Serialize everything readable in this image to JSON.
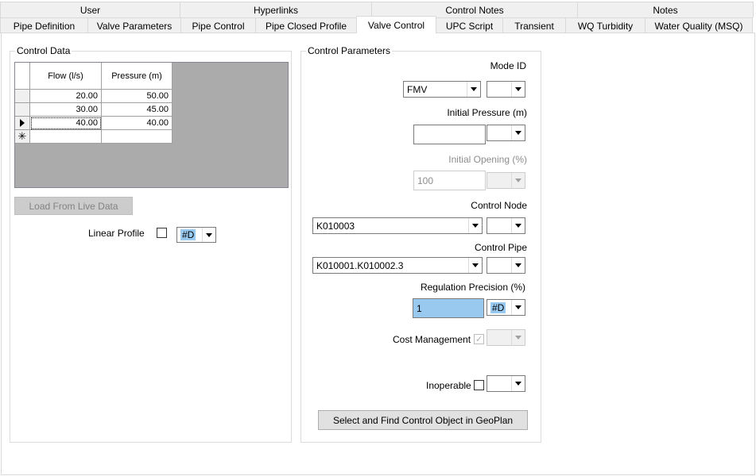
{
  "tabs_top": [
    "User",
    "Hyperlinks",
    "Control Notes",
    "Notes"
  ],
  "tabs_bottom": [
    "Pipe Definition",
    "Valve Parameters",
    "Pipe Control",
    "Pipe Closed Profile",
    "Valve Control",
    "UPC Script",
    "Transient",
    "WQ Turbidity",
    "Water Quality (MSQ)"
  ],
  "active_tab": "Valve Control",
  "control_data": {
    "legend": "Control Data",
    "columns": [
      "Flow (l/s)",
      "Pressure (m)"
    ],
    "rows": [
      {
        "flow": "20.00",
        "pressure": "50.00"
      },
      {
        "flow": "30.00",
        "pressure": "45.00"
      },
      {
        "flow": "40.00",
        "pressure": "40.00"
      }
    ],
    "load_button": "Load From Live Data",
    "linear_profile_label": "Linear Profile",
    "linear_profile_flag": "#D"
  },
  "control_parameters": {
    "legend": "Control Parameters",
    "mode_id_label": "Mode ID",
    "mode_id_value": "FMV",
    "initial_pressure_label": "Initial Pressure (m)",
    "initial_pressure_value": "",
    "initial_opening_label": "Initial Opening (%)",
    "initial_opening_value": "100",
    "control_node_label": "Control Node",
    "control_node_value": "K010003",
    "control_pipe_label": "Control Pipe",
    "control_pipe_value": "K010001.K010002.3",
    "regulation_precision_label": "Regulation Precision (%)",
    "regulation_precision_value": "1",
    "regulation_precision_flag": "#D",
    "cost_management_label": "Cost Management",
    "inoperable_label": "Inoperable",
    "select_button": "Select and Find Control Object in GeoPlan"
  },
  "colors": {
    "highlight": "#99c9ef",
    "tab_bg": "#f0f0f0",
    "grid_bg": "#ababab"
  }
}
